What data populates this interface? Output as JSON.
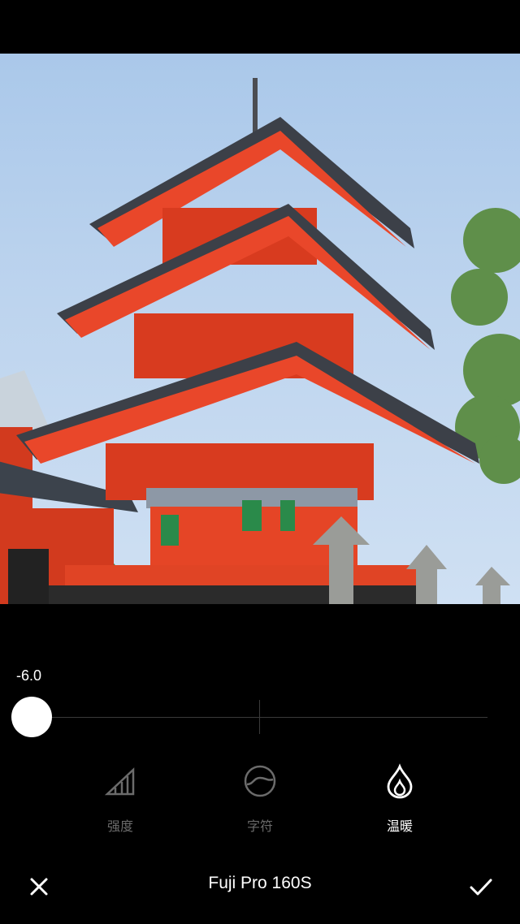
{
  "adjustment": {
    "value_label": "-6.0",
    "slider_value": -6.0
  },
  "tools": [
    {
      "label": "强度",
      "icon": "strength-icon",
      "active": false
    },
    {
      "label": "字符",
      "icon": "character-icon",
      "active": false
    },
    {
      "label": "温暖",
      "icon": "warmth-icon",
      "active": true
    }
  ],
  "bottom_bar": {
    "filter_name": "Fuji Pro 160S",
    "close_icon": "close-icon",
    "confirm_icon": "checkmark-icon"
  },
  "photo": {
    "subject": "pagoda-photo"
  },
  "colors": {
    "background": "#000000",
    "active_text": "#ffffff",
    "inactive_text": "#6b6b6b"
  }
}
